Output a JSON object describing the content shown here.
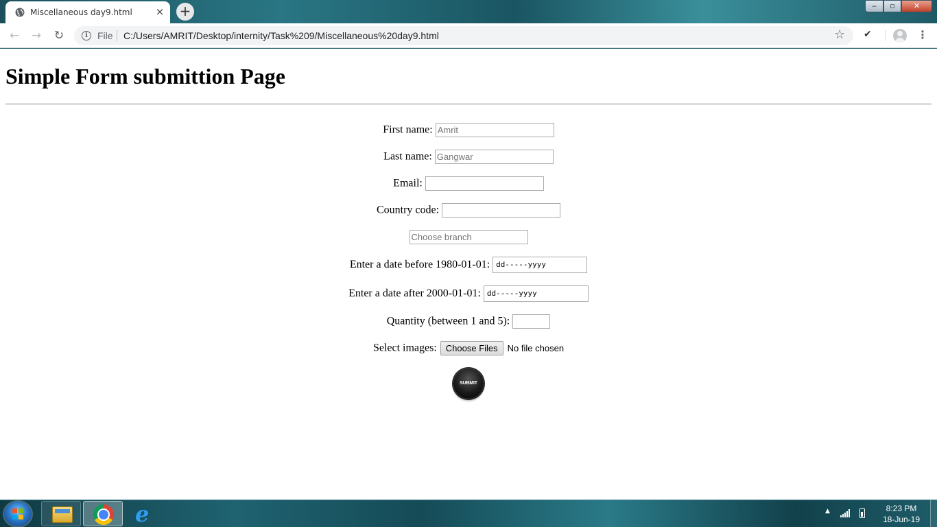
{
  "browser": {
    "tab_title": "Miscellaneous day9.html",
    "tab_close": "×",
    "new_tab": "+",
    "window_min": "‒",
    "window_max": "▫",
    "window_close": "✕",
    "back": "←",
    "forward": "→",
    "reload": "↻",
    "info_symbol": "i",
    "scheme_label": "File",
    "url": "C:/Users/AMRIT/Desktop/internity/Task%209/Miscellaneous%20day9.html",
    "star": "☆",
    "check": "✔",
    "menu": "⋮"
  },
  "page": {
    "heading": "Simple Form submittion Page",
    "first_name": {
      "label": "First name:",
      "placeholder": "Amrit"
    },
    "last_name": {
      "label": "Last name:",
      "placeholder": "Gangwar"
    },
    "email": {
      "label": "Email:"
    },
    "country_code": {
      "label": "Country code:"
    },
    "branch": {
      "placeholder": "Choose branch"
    },
    "date_before": {
      "label": "Enter a date before 1980-01-01:",
      "value": "dd-----yyyy"
    },
    "date_after": {
      "label": "Enter a date after 2000-01-01:",
      "value": "dd-----yyyy"
    },
    "quantity": {
      "label": "Quantity (between 1 and 5):"
    },
    "images": {
      "label": "Select images:",
      "button": "Choose Files",
      "status": "No file chosen"
    },
    "submit": {
      "label": "SUBMIT"
    }
  },
  "taskbar": {
    "tray_arrow": "▲",
    "time": "8:23 PM",
    "date": "18-Jun-19",
    "ie_glyph": "e"
  },
  "icons": {
    "tab_favicon": "globe-icon",
    "start": "windows-start-icon",
    "explorer": "folder-icon",
    "chrome": "chrome-icon",
    "ie": "internet-explorer-icon"
  }
}
